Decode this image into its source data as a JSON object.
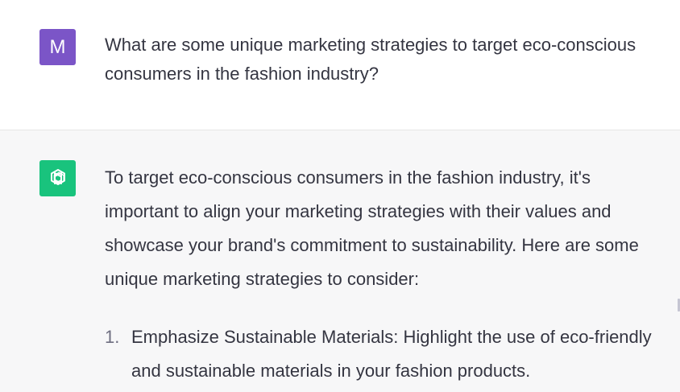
{
  "user_message": {
    "avatar_letter": "M",
    "avatar_color": "#7b55c7",
    "text": "What are some unique marketing strategies to target eco-conscious consumers in the fashion industry?"
  },
  "assistant_message": {
    "avatar_icon": "openai-logo-icon",
    "avatar_color": "#19c37d",
    "intro": "To target eco-conscious consumers in the fashion industry, it's important to align your marketing strategies with their values and showcase your brand's commitment to sustainability. Here are some unique marketing strategies to consider:",
    "list": [
      {
        "number": "1.",
        "text": "Emphasize Sustainable Materials: Highlight the use of eco-friendly and sustainable materials in your fashion products."
      }
    ]
  }
}
